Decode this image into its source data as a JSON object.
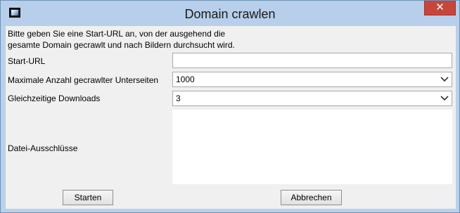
{
  "window": {
    "title": "Domain crawlen",
    "close_glyph": "✕",
    "icon": "image-icon"
  },
  "intro": {
    "line1": "Bitte geben Sie eine Start-URL an, von der ausgehend die",
    "line2": "gesamte Domain gecrawlt und nach Bildern durchsucht wird."
  },
  "form": {
    "start_url_label": "Start-URL",
    "start_url_value": "",
    "max_pages_label": "Maximale Anzahl gecrawlter Unterseiten",
    "max_pages_value": "1000",
    "downloads_label": "Gleichzeitige Downloads",
    "downloads_value": "3",
    "exclusions_label": "Datei-Ausschlüsse",
    "exclusions_value": ""
  },
  "buttons": {
    "start": "Starten",
    "cancel": "Abbrechen"
  }
}
